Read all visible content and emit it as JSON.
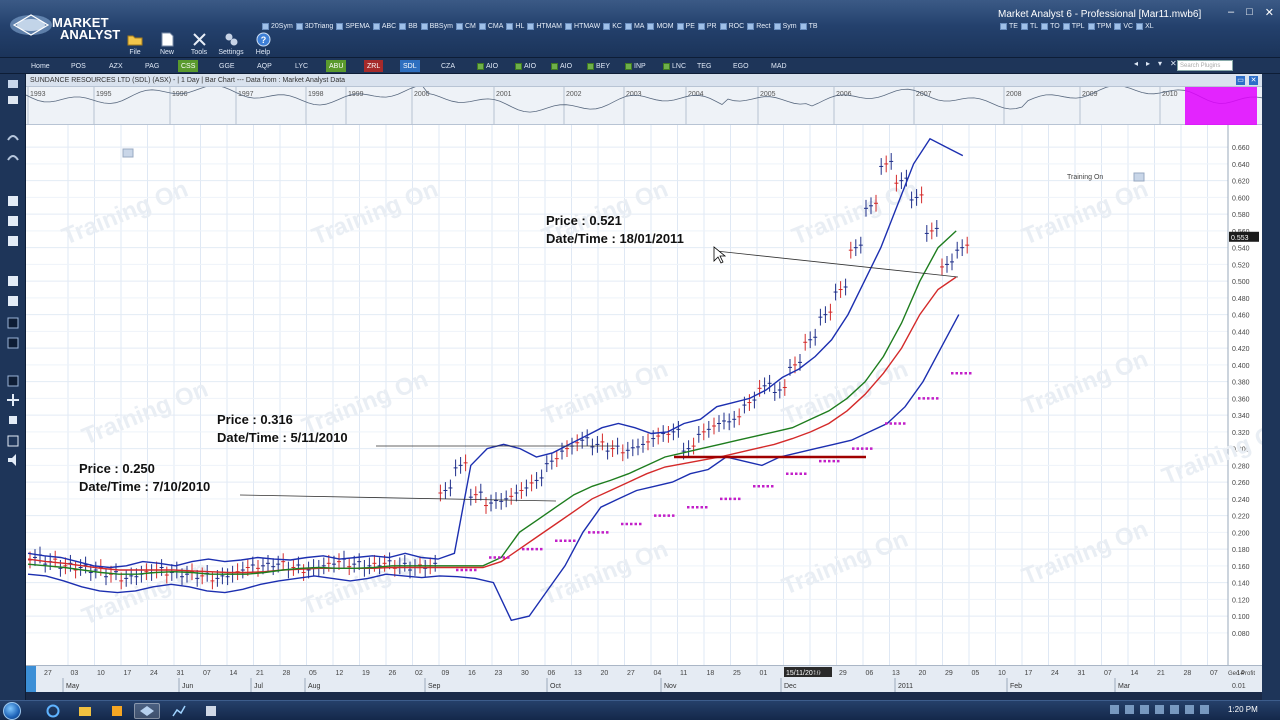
{
  "brand": {
    "line1": "MARKET",
    "line2": "ANALYST"
  },
  "window_title": "Market Analyst 6 - Professional [Mar11.mwb6]",
  "main_tools": [
    {
      "label": "File",
      "icon": "folder-icon"
    },
    {
      "label": "New",
      "icon": "new-document-icon"
    },
    {
      "label": "Tools",
      "icon": "tools-icon"
    },
    {
      "label": "Settings",
      "icon": "settings-icon"
    },
    {
      "label": "Help",
      "icon": "help-icon"
    }
  ],
  "indicator_tools": [
    "20Sym",
    "3DTriang",
    "SPEMA",
    "ABC",
    "BB",
    "BBSym",
    "CM",
    "CMA",
    "HL",
    "HTMAM",
    "HTMAW",
    "KC",
    "MA",
    "MOM",
    "PE",
    "PR",
    "ROC",
    "Rect",
    "Sym",
    "TB",
    "TE",
    "TL",
    "TO",
    "TPL",
    "TPM",
    "VC",
    "XL"
  ],
  "tabs": [
    {
      "label": "Home",
      "style": "plain"
    },
    {
      "label": "POS",
      "style": "plain"
    },
    {
      "label": "AZX",
      "style": "plain"
    },
    {
      "label": "PAG",
      "style": "plain"
    },
    {
      "label": "CSS",
      "style": "green"
    },
    {
      "label": "GGE",
      "style": "plain"
    },
    {
      "label": "AQP",
      "style": "plain"
    },
    {
      "label": "LYC",
      "style": "plain"
    },
    {
      "label": "ABU",
      "style": "green"
    },
    {
      "label": "ZRL",
      "style": "red"
    },
    {
      "label": "SDL",
      "style": "blue"
    },
    {
      "label": "CZA",
      "style": "plain"
    },
    {
      "label": "AIO",
      "style": "plain"
    },
    {
      "label": "AIO",
      "style": "plain"
    },
    {
      "label": "AIO",
      "style": "plain"
    },
    {
      "label": "BEY",
      "style": "plain"
    },
    {
      "label": "INP",
      "style": "plain"
    },
    {
      "label": "LNC",
      "style": "plain"
    },
    {
      "label": "TEG",
      "style": "plain"
    },
    {
      "label": "EGO",
      "style": "plain"
    },
    {
      "label": "MAD",
      "style": "plain"
    }
  ],
  "search_placeholder": "Search Plugins",
  "chart_header": "SUNDANCE RESOURCES LTD (SDL) (ASX) - | 1 Day | Bar Chart --- Data from : Market Analyst Data",
  "overview_years": [
    "1993",
    "1995",
    "1996",
    "1997",
    "1998",
    "1999",
    "2000",
    "2001",
    "2002",
    "2003",
    "2004",
    "2005",
    "2006",
    "2007",
    "2008",
    "2009",
    "2010"
  ],
  "watermark": "Training On",
  "training_label": "Training On",
  "current_price": "0.553",
  "annotations": [
    {
      "price_label": "Price : 0.521",
      "date_label": "Date/Time : 18/01/2011"
    },
    {
      "price_label": "Price : 0.316",
      "date_label": "Date/Time : 5/11/2010"
    },
    {
      "price_label": "Price : 0.250",
      "date_label": "Date/Time : 7/10/2010"
    }
  ],
  "x_day_labels": [
    "27",
    "03",
    "10",
    "17",
    "24",
    "31",
    "07",
    "14",
    "21",
    "28",
    "05",
    "12",
    "19",
    "26",
    "02",
    "09",
    "16",
    "23",
    "30",
    "06",
    "13",
    "20",
    "27",
    "04",
    "11",
    "18",
    "25",
    "01",
    "15/11/2010",
    "22",
    "29",
    "06",
    "13",
    "20",
    "29",
    "05",
    "10",
    "17",
    "24",
    "31",
    "07",
    "14",
    "21",
    "28",
    "07",
    "14",
    "21",
    "28"
  ],
  "x_month_labels": [
    "May",
    "Jun",
    "Jul",
    "Aug",
    "Sep",
    "Oct",
    "Nov",
    "Dec",
    "2011",
    "Feb",
    "Mar"
  ],
  "y_axis_note": "Geo Profit",
  "y_axis_note2": "0.01",
  "clock": "1:20 PM",
  "chart_data": {
    "type": "line",
    "instrument": "SUNDANCE RESOURCES LTD (SDL) (ASX)",
    "y_ticks": [
      0.66,
      0.64,
      0.62,
      0.6,
      0.58,
      0.56,
      0.54,
      0.52,
      0.5,
      0.48,
      0.46,
      0.44,
      0.42,
      0.4,
      0.38,
      0.36,
      0.34,
      0.32,
      0.3,
      0.28,
      0.26,
      0.24,
      0.22,
      0.2,
      0.18,
      0.16,
      0.14,
      0.12,
      0.1,
      0.08
    ],
    "ylim": [
      0.075,
      0.665
    ],
    "price_markers": [
      {
        "date": "18/01/2011",
        "price": 0.521
      },
      {
        "date": "5/11/2010",
        "price": 0.316
      },
      {
        "date": "7/10/2010",
        "price": 0.25
      }
    ],
    "series": [
      {
        "name": "Close",
        "color": "#2b2f88",
        "values": [
          0.17,
          0.165,
          0.16,
          0.158,
          0.155,
          0.15,
          0.145,
          0.15,
          0.155,
          0.152,
          0.15,
          0.148,
          0.145,
          0.15,
          0.158,
          0.16,
          0.162,
          0.158,
          0.155,
          0.16,
          0.165,
          0.162,
          0.16,
          0.163,
          0.16,
          0.158,
          0.16,
          0.25,
          0.28,
          0.245,
          0.235,
          0.24,
          0.25,
          0.262,
          0.285,
          0.3,
          0.31,
          0.305,
          0.3,
          0.298,
          0.305,
          0.315,
          0.32,
          0.3,
          0.32,
          0.33,
          0.335,
          0.355,
          0.375,
          0.37,
          0.4,
          0.43,
          0.46,
          0.49,
          0.54,
          0.59,
          0.64,
          0.62,
          0.6,
          0.56,
          0.52,
          0.54
        ]
      },
      {
        "name": "Upper band",
        "color": "#1c2fb0",
        "values": [
          0.175,
          0.172,
          0.17,
          0.165,
          0.16,
          0.158,
          0.16,
          0.165,
          0.163,
          0.16,
          0.165,
          0.168,
          0.165,
          0.167,
          0.17,
          0.168,
          0.167,
          0.17,
          0.172,
          0.168,
          0.17,
          0.172,
          0.17,
          0.175,
          0.17,
          0.168,
          0.175,
          0.28,
          0.3,
          0.305,
          0.3,
          0.29,
          0.295,
          0.305,
          0.315,
          0.325,
          0.33,
          0.325,
          0.318,
          0.32,
          0.33,
          0.335,
          0.35,
          0.355,
          0.36,
          0.37,
          0.385,
          0.395,
          0.41,
          0.43,
          0.46,
          0.5,
          0.54,
          0.59,
          0.64,
          0.67,
          0.66,
          0.65
        ]
      },
      {
        "name": "Lower band",
        "color": "#1c2fb0",
        "values": [
          0.15,
          0.148,
          0.142,
          0.135,
          0.13,
          0.128,
          0.13,
          0.135,
          0.138,
          0.135,
          0.13,
          0.128,
          0.132,
          0.138,
          0.142,
          0.145,
          0.148,
          0.145,
          0.142,
          0.145,
          0.15,
          0.148,
          0.146,
          0.148,
          0.147,
          0.145,
          0.14,
          0.095,
          0.1,
          0.13,
          0.16,
          0.2,
          0.23,
          0.24,
          0.25,
          0.255,
          0.26,
          0.27,
          0.275,
          0.29,
          0.285,
          0.28,
          0.29,
          0.295,
          0.3,
          0.305,
          0.31,
          0.32,
          0.33,
          0.35,
          0.38,
          0.42,
          0.46
        ]
      },
      {
        "name": "Fast MA",
        "color": "#1e7d1e",
        "values": [
          0.162,
          0.16,
          0.158,
          0.155,
          0.152,
          0.15,
          0.15,
          0.152,
          0.153,
          0.152,
          0.15,
          0.15,
          0.15,
          0.152,
          0.155,
          0.157,
          0.158,
          0.157,
          0.157,
          0.158,
          0.16,
          0.16,
          0.16,
          0.16,
          0.16,
          0.16,
          0.17,
          0.2,
          0.215,
          0.23,
          0.245,
          0.255,
          0.262,
          0.27,
          0.28,
          0.29,
          0.295,
          0.3,
          0.305,
          0.31,
          0.315,
          0.32,
          0.325,
          0.335,
          0.345,
          0.36,
          0.38,
          0.41,
          0.45,
          0.5,
          0.54,
          0.56
        ]
      },
      {
        "name": "Slow MA",
        "color": "#d42a2a",
        "values": [
          0.168,
          0.165,
          0.163,
          0.16,
          0.157,
          0.155,
          0.155,
          0.155,
          0.155,
          0.154,
          0.153,
          0.152,
          0.152,
          0.153,
          0.155,
          0.156,
          0.157,
          0.157,
          0.157,
          0.157,
          0.158,
          0.158,
          0.158,
          0.158,
          0.158,
          0.158,
          0.165,
          0.18,
          0.195,
          0.21,
          0.225,
          0.24,
          0.25,
          0.26,
          0.27,
          0.278,
          0.282,
          0.286,
          0.29,
          0.295,
          0.3,
          0.305,
          0.312,
          0.32,
          0.33,
          0.345,
          0.365,
          0.39,
          0.42,
          0.46,
          0.49,
          0.505
        ]
      },
      {
        "name": "Stop dots",
        "color": "#c21fc8",
        "values": [
          0.155,
          0.17,
          0.18,
          0.19,
          0.2,
          0.21,
          0.22,
          0.23,
          0.24,
          0.255,
          0.27,
          0.285,
          0.3,
          0.33,
          0.36,
          0.39
        ]
      }
    ]
  }
}
